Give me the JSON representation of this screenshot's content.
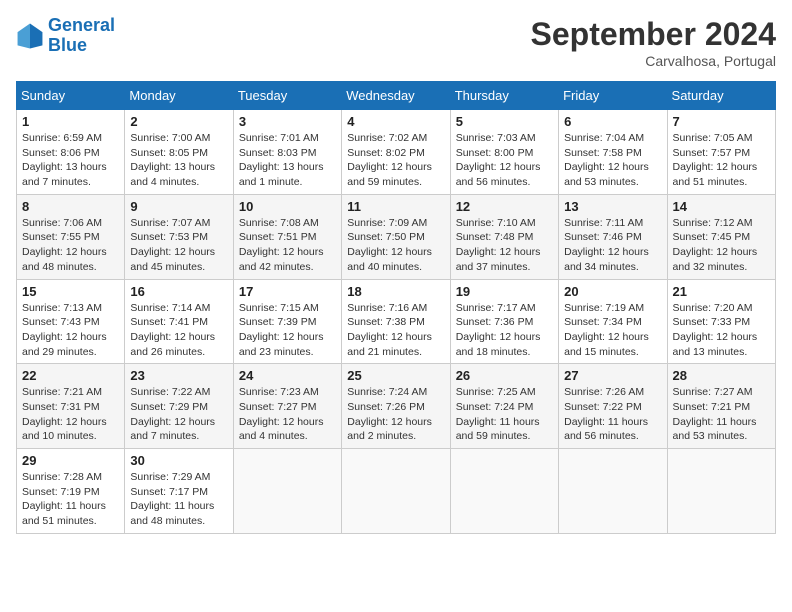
{
  "header": {
    "logo_line1": "General",
    "logo_line2": "Blue",
    "month": "September 2024",
    "location": "Carvalhosa, Portugal"
  },
  "days_of_week": [
    "Sunday",
    "Monday",
    "Tuesday",
    "Wednesday",
    "Thursday",
    "Friday",
    "Saturday"
  ],
  "weeks": [
    [
      {
        "day": "1",
        "info": "Sunrise: 6:59 AM\nSunset: 8:06 PM\nDaylight: 13 hours\nand 7 minutes."
      },
      {
        "day": "2",
        "info": "Sunrise: 7:00 AM\nSunset: 8:05 PM\nDaylight: 13 hours\nand 4 minutes."
      },
      {
        "day": "3",
        "info": "Sunrise: 7:01 AM\nSunset: 8:03 PM\nDaylight: 13 hours\nand 1 minute."
      },
      {
        "day": "4",
        "info": "Sunrise: 7:02 AM\nSunset: 8:02 PM\nDaylight: 12 hours\nand 59 minutes."
      },
      {
        "day": "5",
        "info": "Sunrise: 7:03 AM\nSunset: 8:00 PM\nDaylight: 12 hours\nand 56 minutes."
      },
      {
        "day": "6",
        "info": "Sunrise: 7:04 AM\nSunset: 7:58 PM\nDaylight: 12 hours\nand 53 minutes."
      },
      {
        "day": "7",
        "info": "Sunrise: 7:05 AM\nSunset: 7:57 PM\nDaylight: 12 hours\nand 51 minutes."
      }
    ],
    [
      {
        "day": "8",
        "info": "Sunrise: 7:06 AM\nSunset: 7:55 PM\nDaylight: 12 hours\nand 48 minutes."
      },
      {
        "day": "9",
        "info": "Sunrise: 7:07 AM\nSunset: 7:53 PM\nDaylight: 12 hours\nand 45 minutes."
      },
      {
        "day": "10",
        "info": "Sunrise: 7:08 AM\nSunset: 7:51 PM\nDaylight: 12 hours\nand 42 minutes."
      },
      {
        "day": "11",
        "info": "Sunrise: 7:09 AM\nSunset: 7:50 PM\nDaylight: 12 hours\nand 40 minutes."
      },
      {
        "day": "12",
        "info": "Sunrise: 7:10 AM\nSunset: 7:48 PM\nDaylight: 12 hours\nand 37 minutes."
      },
      {
        "day": "13",
        "info": "Sunrise: 7:11 AM\nSunset: 7:46 PM\nDaylight: 12 hours\nand 34 minutes."
      },
      {
        "day": "14",
        "info": "Sunrise: 7:12 AM\nSunset: 7:45 PM\nDaylight: 12 hours\nand 32 minutes."
      }
    ],
    [
      {
        "day": "15",
        "info": "Sunrise: 7:13 AM\nSunset: 7:43 PM\nDaylight: 12 hours\nand 29 minutes."
      },
      {
        "day": "16",
        "info": "Sunrise: 7:14 AM\nSunset: 7:41 PM\nDaylight: 12 hours\nand 26 minutes."
      },
      {
        "day": "17",
        "info": "Sunrise: 7:15 AM\nSunset: 7:39 PM\nDaylight: 12 hours\nand 23 minutes."
      },
      {
        "day": "18",
        "info": "Sunrise: 7:16 AM\nSunset: 7:38 PM\nDaylight: 12 hours\nand 21 minutes."
      },
      {
        "day": "19",
        "info": "Sunrise: 7:17 AM\nSunset: 7:36 PM\nDaylight: 12 hours\nand 18 minutes."
      },
      {
        "day": "20",
        "info": "Sunrise: 7:19 AM\nSunset: 7:34 PM\nDaylight: 12 hours\nand 15 minutes."
      },
      {
        "day": "21",
        "info": "Sunrise: 7:20 AM\nSunset: 7:33 PM\nDaylight: 12 hours\nand 13 minutes."
      }
    ],
    [
      {
        "day": "22",
        "info": "Sunrise: 7:21 AM\nSunset: 7:31 PM\nDaylight: 12 hours\nand 10 minutes."
      },
      {
        "day": "23",
        "info": "Sunrise: 7:22 AM\nSunset: 7:29 PM\nDaylight: 12 hours\nand 7 minutes."
      },
      {
        "day": "24",
        "info": "Sunrise: 7:23 AM\nSunset: 7:27 PM\nDaylight: 12 hours\nand 4 minutes."
      },
      {
        "day": "25",
        "info": "Sunrise: 7:24 AM\nSunset: 7:26 PM\nDaylight: 12 hours\nand 2 minutes."
      },
      {
        "day": "26",
        "info": "Sunrise: 7:25 AM\nSunset: 7:24 PM\nDaylight: 11 hours\nand 59 minutes."
      },
      {
        "day": "27",
        "info": "Sunrise: 7:26 AM\nSunset: 7:22 PM\nDaylight: 11 hours\nand 56 minutes."
      },
      {
        "day": "28",
        "info": "Sunrise: 7:27 AM\nSunset: 7:21 PM\nDaylight: 11 hours\nand 53 minutes."
      }
    ],
    [
      {
        "day": "29",
        "info": "Sunrise: 7:28 AM\nSunset: 7:19 PM\nDaylight: 11 hours\nand 51 minutes."
      },
      {
        "day": "30",
        "info": "Sunrise: 7:29 AM\nSunset: 7:17 PM\nDaylight: 11 hours\nand 48 minutes."
      },
      null,
      null,
      null,
      null,
      null
    ]
  ]
}
